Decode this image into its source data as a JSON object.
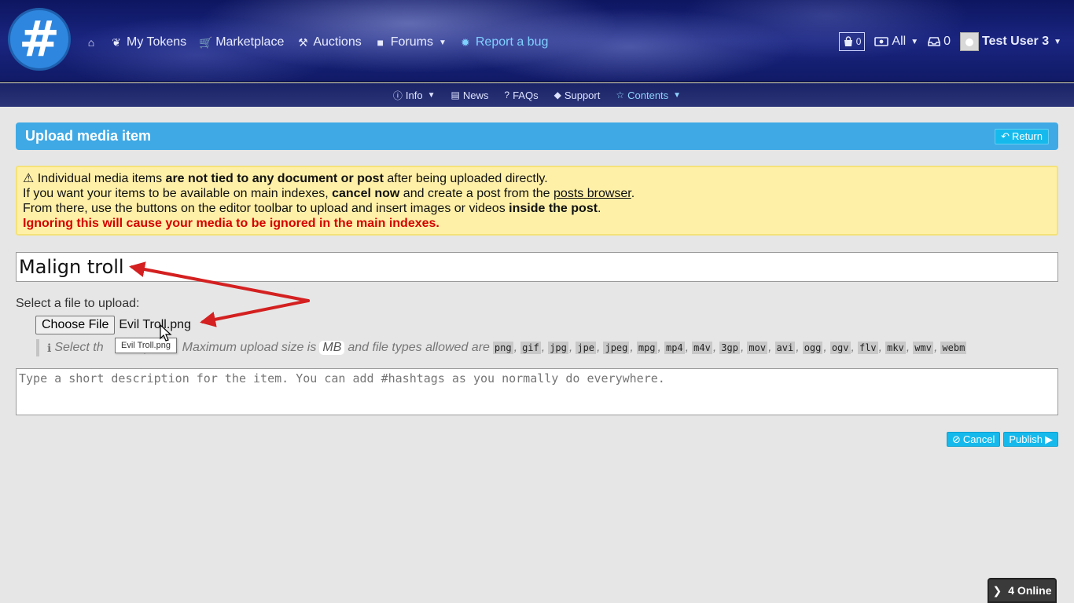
{
  "header": {
    "logo_glyph": "#",
    "nav": [
      {
        "name": "home",
        "icon": "⌂",
        "label": ""
      },
      {
        "name": "my-tokens",
        "icon": "❦",
        "label": "My Tokens"
      },
      {
        "name": "marketplace",
        "icon": "🛒",
        "label": "Marketplace"
      },
      {
        "name": "auctions",
        "icon": "⚒",
        "label": "Auctions"
      },
      {
        "name": "forums",
        "icon": "■",
        "label": "Forums"
      },
      {
        "name": "report-bug",
        "icon": "✹",
        "label": "Report a bug"
      }
    ],
    "cart_count": "0",
    "wallet_label": "All",
    "inbox_count": "0",
    "user_name": "Test User 3"
  },
  "subnav": [
    {
      "icon": "ⓘ",
      "label": "Info"
    },
    {
      "icon": "▤",
      "label": "News"
    },
    {
      "icon": "?",
      "label": "FAQs"
    },
    {
      "icon": "◆",
      "label": "Support"
    },
    {
      "icon": "☆",
      "label": "Contents"
    }
  ],
  "page": {
    "title": "Upload media item",
    "return_label": "Return"
  },
  "warning": {
    "l1_a": "Individual media items ",
    "l1_b": "are not tied to any document or post",
    "l1_c": " after being uploaded directly.",
    "l2_a": "If you want your items to be available on main indexes, ",
    "l2_b": "cancel now",
    "l2_c": " and create a post from the ",
    "l2_link": "posts browser",
    "l2_d": ".",
    "l3_a": "From there, use the buttons on the editor toolbar to upload and insert images or videos ",
    "l3_b": "inside the post",
    "l3_c": ".",
    "l4": "Ignoring this will cause your media to be ignored in the main indexes."
  },
  "form": {
    "title_value": "Malign troll",
    "file_label": "Select a file to upload:",
    "choose_file_label": "Choose File",
    "file_name": "Evil Troll.png",
    "tooltip": "Evil Troll.png",
    "hint_a": "Select th",
    "hint_b": "pload. Maximum upload size is",
    "hint_mb": "MB",
    "hint_c": "and file types allowed are",
    "file_types": [
      "png",
      "gif",
      "jpg",
      "jpe",
      "jpeg",
      "mpg",
      "mp4",
      "m4v",
      "3gp",
      "mov",
      "avi",
      "ogg",
      "ogv",
      "flv",
      "mkv",
      "wmv",
      "webm"
    ],
    "description_placeholder": "Type a short description for the item. You can add #hashtags as you normally do everywhere.",
    "cancel_label": "Cancel",
    "publish_label": "Publish"
  },
  "online_label": "4 Online",
  "colors": {
    "accent": "#3fa9e5",
    "button": "#16b9ec",
    "warning_bg": "#fff0a8",
    "danger": "#d40000",
    "arrow": "#d42020"
  }
}
